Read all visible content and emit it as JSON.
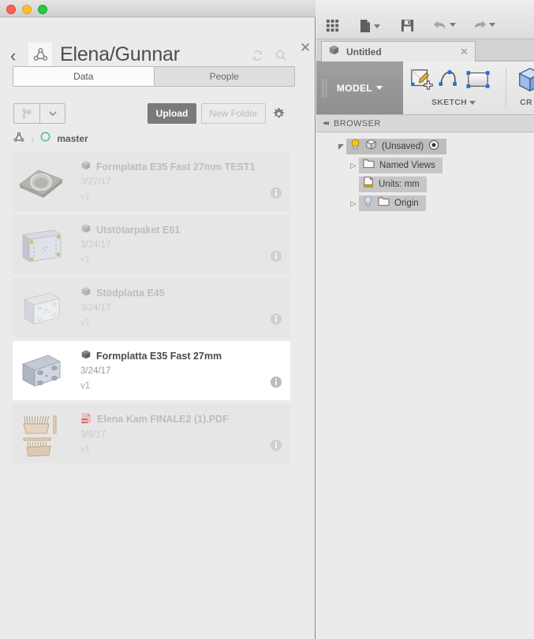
{
  "window": {
    "traffic_lights": [
      "close",
      "minimize",
      "maximize"
    ]
  },
  "data_panel": {
    "back_label": "‹",
    "hub_icon": "fusion-hub-icon",
    "title": "Elena/Gunnar",
    "refresh_icon": "refresh-icon",
    "search_icon": "search-icon",
    "close_label": "✕",
    "tabs": [
      {
        "label": "Data",
        "active": true
      },
      {
        "label": "People",
        "active": false
      }
    ],
    "toolbar": {
      "version_icon": "new-version-icon",
      "dropdown_icon": "chevron-down-icon",
      "upload_label": "Upload",
      "new_folder_label": "New Folder",
      "gear_icon": "gear-icon"
    },
    "breadcrumb": {
      "hub_icon": "fusion-hub-icon",
      "separator": "›",
      "project_icon": "project-circle-icon",
      "project_label": "master"
    },
    "files": [
      {
        "name": "Formplatta E35 Fast 27mm TEST1",
        "date": "3/27/17",
        "version": "v1",
        "type_icon": "cube-icon",
        "active": false,
        "thumb": "plate-with-ring"
      },
      {
        "name": "Utstötarpaket E61",
        "date": "3/24/17",
        "version": "v1",
        "type_icon": "cube-icon",
        "active": false,
        "thumb": "block-plate"
      },
      {
        "name": "Stödplatta E45",
        "date": "3/24/17",
        "version": "v1",
        "type_icon": "cube-icon",
        "active": false,
        "thumb": "square-plate"
      },
      {
        "name": "Formplatta E35 Fast 27mm",
        "date": "3/24/17",
        "version": "v1",
        "type_icon": "cube-icon",
        "active": true,
        "thumb": "corner-holes-plate"
      },
      {
        "name": "Elena Kam FINALE2 (1).PDF",
        "date": "3/9/17",
        "version": "v1",
        "type_icon": "pdf-icon",
        "active": false,
        "thumb": "pdf-comb-drawing"
      }
    ],
    "info_icon": "info-icon"
  },
  "fusion": {
    "toolbar": [
      {
        "name": "app-grid-icon",
        "has_caret": false
      },
      {
        "name": "new-document-icon",
        "has_caret": true
      },
      {
        "name": "save-icon",
        "has_caret": false
      },
      {
        "name": "undo-icon",
        "has_caret": true
      },
      {
        "name": "redo-icon",
        "has_caret": true
      }
    ],
    "document_tab": {
      "icon": "cube-icon",
      "label": "Untitled",
      "close_label": "✕"
    },
    "workspace": {
      "label": "MODEL",
      "caret": "chevron-down-icon"
    },
    "ribbon_groups": [
      {
        "label": "SKETCH",
        "has_caret": true,
        "icons": [
          "create-sketch-icon",
          "spline-icon",
          "rectangle-icon"
        ]
      },
      {
        "label": "CR",
        "has_caret": false,
        "icons": [
          "create-box-icon"
        ]
      }
    ],
    "browser": {
      "collapse_icon": "collapse-left-icon",
      "title": "BROWSER",
      "nodes": [
        {
          "label": "(Unsaved)",
          "indent": 0,
          "twisty": "open",
          "bulb": "on",
          "icon": "cube-icon",
          "suffix_icon": "radio-dot-icon"
        },
        {
          "label": "Named Views",
          "indent": 1,
          "twisty": "closed",
          "bulb": "none",
          "icon": "folder-icon",
          "suffix_icon": ""
        },
        {
          "label": "Units: mm",
          "indent": 1,
          "twisty": "none",
          "bulb": "none",
          "icon": "units-document-icon",
          "suffix_icon": ""
        },
        {
          "label": "Origin",
          "indent": 1,
          "twisty": "closed",
          "bulb": "off",
          "icon": "folder-icon",
          "suffix_icon": ""
        }
      ]
    }
  },
  "colors": {
    "panel_bg": "#ebebeb",
    "row_bg": "#e6e6e6",
    "row_active_bg": "#ffffff",
    "upload_btn": "#7a7a7a",
    "workspace_bg": "#9a9a9a",
    "project_accent": "#3fbfa5",
    "pdf_red": "#d9736f",
    "bulb_on": "#f5c518"
  }
}
